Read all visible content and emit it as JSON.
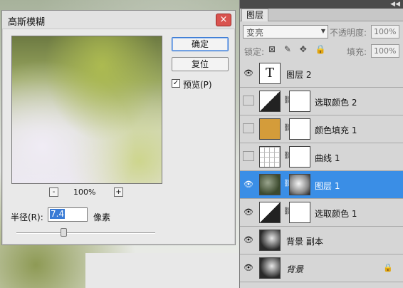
{
  "dialog": {
    "title": "高斯模糊",
    "close": "×",
    "ok_label": "确定",
    "reset_label": "复位",
    "preview_label": "预览(P)",
    "preview_checked": "✓",
    "zoom_minus": "-",
    "zoom_plus": "+",
    "zoom_level": "100%",
    "radius_label": "半径(R):",
    "radius_value": "7.4",
    "radius_unit": "像素"
  },
  "panel": {
    "tab": "图层",
    "collapse": "◀◀",
    "blend_mode": "变亮",
    "blend_arrow": "▼",
    "opacity_label": "不透明度:",
    "opacity_value": "100%",
    "lock_label": "锁定:",
    "lock_icons": "⊠ ✎ ✥ 🔒",
    "fill_label": "填充:",
    "fill_value": "100%",
    "layers": [
      {
        "name": "图层 2",
        "visible": true
      },
      {
        "name": "选取颜色 2",
        "visible": false
      },
      {
        "name": "颜色填充 1",
        "visible": false
      },
      {
        "name": "曲线 1",
        "visible": false
      },
      {
        "name": "图层 1",
        "visible": true
      },
      {
        "name": "选取颜色 1",
        "visible": true
      },
      {
        "name": "背景 副本",
        "visible": true
      },
      {
        "name": "背景",
        "visible": true
      }
    ],
    "eye_icon": "👁",
    "chain_icon": "⛓",
    "text_layer_icon": "T",
    "lock_icon": "🔒"
  }
}
